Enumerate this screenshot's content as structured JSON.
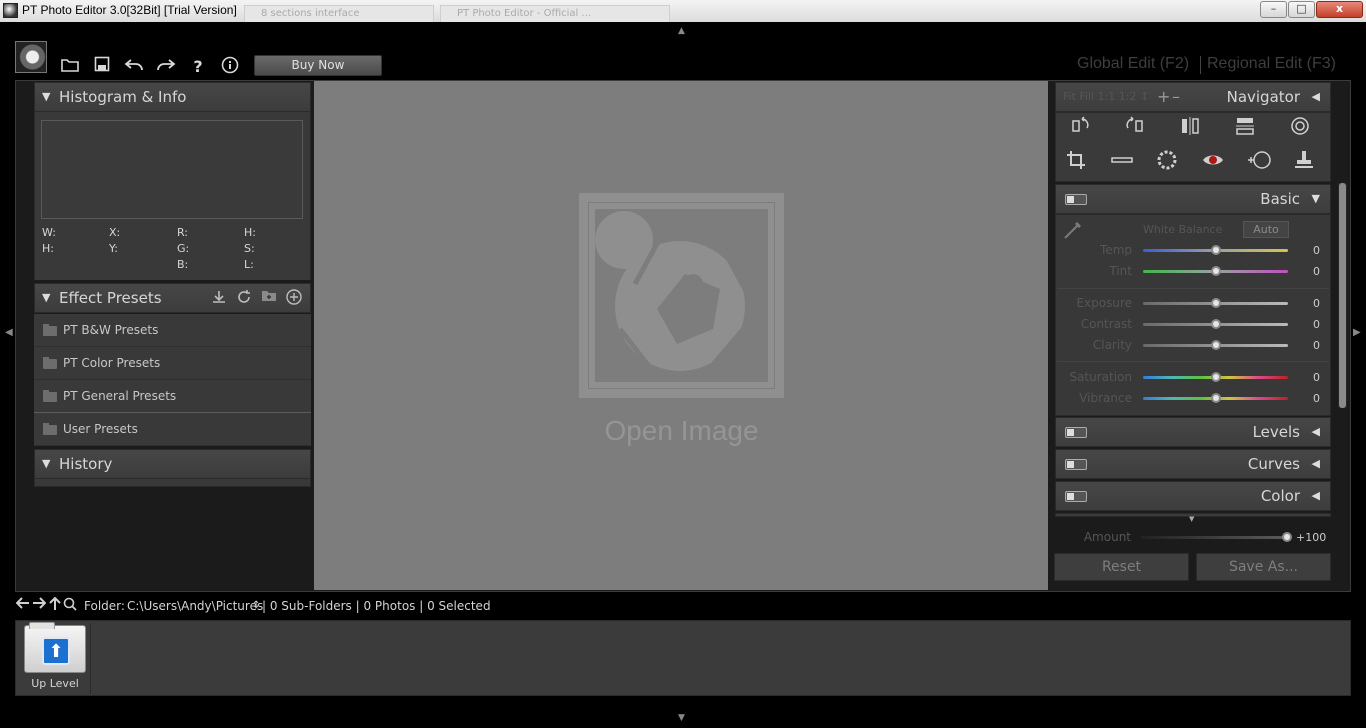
{
  "window": {
    "title": "PT Photo Editor 3.0[32Bit] [Trial Version]",
    "ghost_tab_1": "8 sections interface",
    "ghost_tab_2": "PT Photo Editor - Official ...",
    "min_label": "–",
    "max_label": "□",
    "close_label": "x"
  },
  "toolbar": {
    "buy_label": "Buy Now",
    "help_label": "?",
    "info_label": "i",
    "mode_global": "Global Edit (F2)",
    "mode_regional": "Regional Edit (F3)"
  },
  "histogram": {
    "title": "Histogram & Info",
    "labels": [
      "W:",
      "X:",
      "R:",
      "H:",
      "H:",
      "Y:",
      "G:",
      "S:",
      "B:",
      "L:"
    ]
  },
  "effect_presets": {
    "title": "Effect Presets",
    "items": [
      "PT B&W Presets",
      "PT Color Presets",
      "PT General Presets",
      "User Presets"
    ]
  },
  "history": {
    "title": "History"
  },
  "canvas": {
    "open_label": "Open Image"
  },
  "navigator": {
    "title": "Navigator",
    "zoom_options": "Fit  Fill  1:1  1:2 ↕",
    "zoom_in": "+",
    "zoom_out": "–"
  },
  "basic": {
    "title": "Basic",
    "white_balance_label": "White Balance",
    "auto_label": "Auto",
    "sliders": [
      {
        "label": "Temp",
        "value": "0",
        "position": 0.5
      },
      {
        "label": "Tint",
        "value": "0",
        "position": 0.5
      },
      {
        "label": "Exposure",
        "value": "0",
        "position": 0.5
      },
      {
        "label": "Contrast",
        "value": "0",
        "position": 0.5
      },
      {
        "label": "Clarity",
        "value": "0",
        "position": 0.5
      },
      {
        "label": "Saturation",
        "value": "0",
        "position": 0.5
      },
      {
        "label": "Vibrance",
        "value": "0",
        "position": 0.5
      }
    ]
  },
  "panels": {
    "levels": "Levels",
    "curves": "Curves",
    "color": "Color"
  },
  "amount": {
    "label": "Amount",
    "value": "+100",
    "position": 1.0
  },
  "buttons": {
    "reset": "Reset",
    "save_as": "Save As..."
  },
  "pathbar": {
    "folder_label": "Folder:",
    "path": "C:\\Users\\Andy\\Pictures",
    "selector": "↕",
    "stats": "| 0 Sub-Folders | 0 Photos | 0 Selected"
  },
  "filmstrip": {
    "up_label": "Up Level"
  },
  "colors": {
    "temp_track": "linear-gradient(90deg,#3b5bdc,#9aa0a0,#d8c34b)",
    "tint_track": "linear-gradient(90deg,#3fb84a,#9aa0a0,#c24fc0)",
    "neutral_track": "linear-gradient(90deg,#6a6a6a,#bbbbbb)",
    "sat_track": "linear-gradient(90deg,#3a7ad9,#4fb7b2,#5ec040,#d0c440,#d84a8a,#c02020)",
    "vib_track": "linear-gradient(90deg,#3a7ad9,#4fb7b2,#5ec040,#d0c440,#d84a8a,#c02020)"
  }
}
